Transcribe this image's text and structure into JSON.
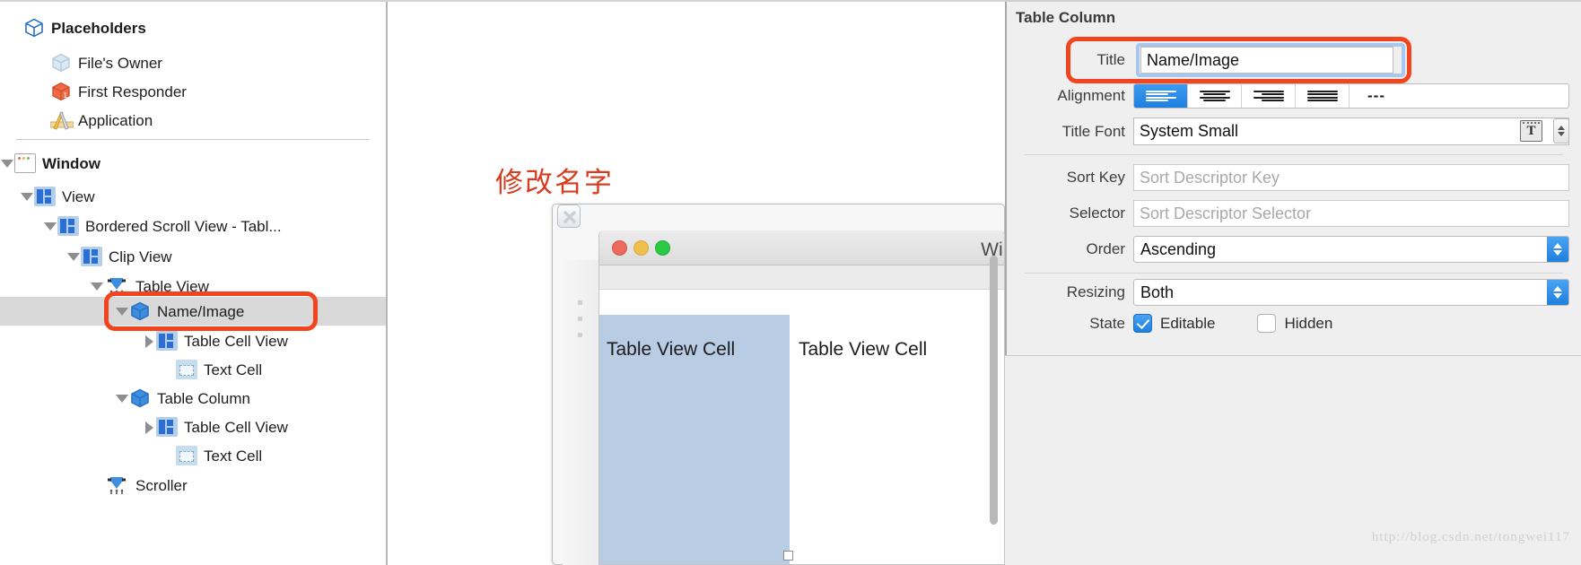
{
  "app": {
    "annotation_color": "#f2441d",
    "accent_blue": "#2a7fe0",
    "selection_grey": "#d9d9d9"
  },
  "outline": {
    "section_placeholders": "Placeholders",
    "rows": [
      {
        "label": "Placeholders",
        "icon": "cube-blue-outline-icon",
        "indent": 0,
        "twisty": "none",
        "bold": true,
        "selected": false
      },
      {
        "label": "File's Owner",
        "icon": "cube-light-icon",
        "indent": 1,
        "twisty": "none",
        "bold": false,
        "selected": false
      },
      {
        "label": "First Responder",
        "icon": "cube-red-one-icon",
        "indent": 1,
        "twisty": "none",
        "bold": false,
        "selected": false
      },
      {
        "label": "Application",
        "icon": "ruler-pencil-icon",
        "indent": 1,
        "twisty": "none",
        "bold": false,
        "selected": false
      },
      {
        "label": "Window",
        "icon": "window-icon",
        "indent": 0,
        "twisty": "down",
        "bold": true,
        "selected": false
      },
      {
        "label": "View",
        "icon": "view-icon",
        "indent": 1,
        "twisty": "down",
        "bold": false,
        "selected": false
      },
      {
        "label": "Bordered Scroll View - Tabl...",
        "icon": "view-icon",
        "indent": 2,
        "twisty": "down",
        "bold": false,
        "selected": false
      },
      {
        "label": "Clip View",
        "icon": "view-icon",
        "indent": 3,
        "twisty": "down",
        "bold": false,
        "selected": false
      },
      {
        "label": "Table View",
        "icon": "table-view-icon",
        "indent": 4,
        "twisty": "down",
        "bold": false,
        "selected": false
      },
      {
        "label": "Name/Image",
        "icon": "cube-blue-icon",
        "indent": 5,
        "twisty": "down",
        "bold": false,
        "selected": true
      },
      {
        "label": "Table Cell View",
        "icon": "view-icon",
        "indent": 6,
        "twisty": "right",
        "bold": false,
        "selected": false
      },
      {
        "label": "Text Cell",
        "icon": "text-cell-icon",
        "indent": 7,
        "twisty": "none",
        "bold": false,
        "selected": false
      },
      {
        "label": "Table Column",
        "icon": "cube-blue-icon",
        "indent": 5,
        "twisty": "down",
        "bold": false,
        "selected": false
      },
      {
        "label": "Table Cell View",
        "icon": "view-icon",
        "indent": 6,
        "twisty": "right",
        "bold": false,
        "selected": false
      },
      {
        "label": "Text Cell",
        "icon": "text-cell-icon",
        "indent": 7,
        "twisty": "none",
        "bold": false,
        "selected": false
      },
      {
        "label": "Scroller",
        "icon": "scroller-icon",
        "indent": 4,
        "twisty": "none",
        "bold": false,
        "selected": false
      }
    ]
  },
  "canvas": {
    "annotation_text": "修改名字",
    "window_title": "Wind",
    "cells": [
      {
        "text": "Table View Cell",
        "highlighted": true
      },
      {
        "text": "Table View Cell",
        "highlighted": false
      }
    ]
  },
  "inspector": {
    "title": "Table Column",
    "title_label": "Title",
    "title_value": "Name/Image",
    "alignment_label": "Alignment",
    "alignment_options": [
      "left",
      "center",
      "right",
      "justified",
      "natural"
    ],
    "alignment_selected": "left",
    "title_font_label": "Title Font",
    "title_font_value": "System Small",
    "sort_key_label": "Sort Key",
    "sort_key_placeholder": "Sort Descriptor Key",
    "sort_key_value": "",
    "selector_label": "Selector",
    "selector_placeholder": "Sort Descriptor Selector",
    "selector_value": "",
    "order_label": "Order",
    "order_value": "Ascending",
    "resizing_label": "Resizing",
    "resizing_value": "Both",
    "state_label": "State",
    "editable_label": "Editable",
    "editable_checked": true,
    "hidden_label": "Hidden",
    "hidden_checked": false
  },
  "watermark": "http://blog.csdn.net/tongwei117"
}
